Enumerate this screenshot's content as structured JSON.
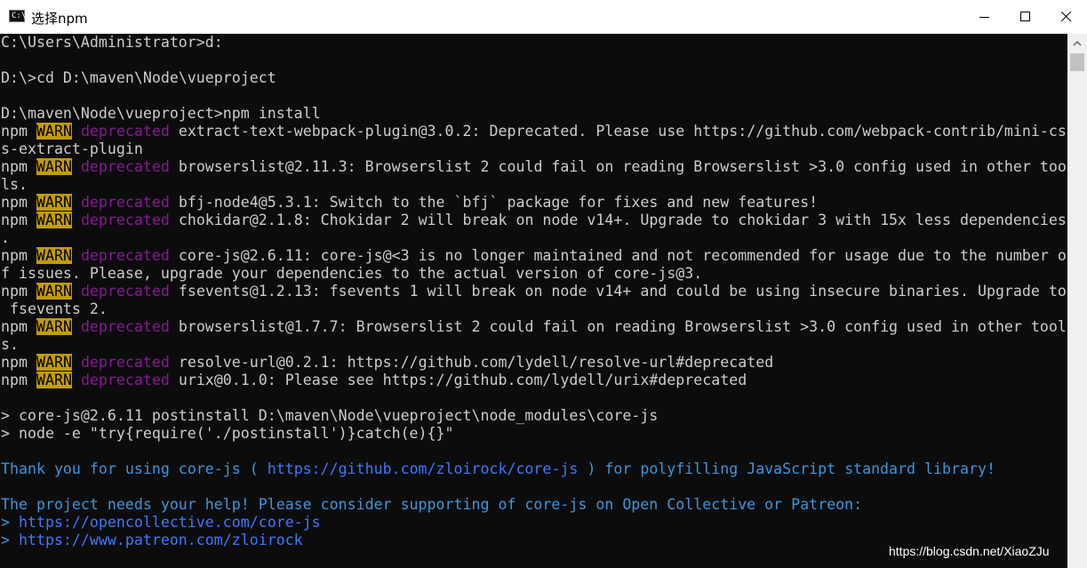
{
  "window": {
    "title": "选择npm",
    "icon_name": "terminal-icon"
  },
  "terminal": {
    "lines": [
      {
        "segments": [
          {
            "text": "C:\\Users\\Administrator>d:",
            "style": "default"
          }
        ]
      },
      {
        "segments": [
          {
            "text": "",
            "style": "default"
          }
        ]
      },
      {
        "segments": [
          {
            "text": "D:\\>cd D:\\maven\\Node\\vueproject",
            "style": "default"
          }
        ]
      },
      {
        "segments": [
          {
            "text": "",
            "style": "default"
          }
        ]
      },
      {
        "segments": [
          {
            "text": "D:\\maven\\Node\\vueproject>npm install",
            "style": "default"
          }
        ]
      },
      {
        "segments": [
          {
            "text": "npm ",
            "style": "default"
          },
          {
            "text": "WARN",
            "style": "warn"
          },
          {
            "text": " ",
            "style": "default"
          },
          {
            "text": "deprecated",
            "style": "dep"
          },
          {
            "text": " extract-text-webpack-plugin@3.0.2: Deprecated. Please use https://github.com/webpack-contrib/mini-cs",
            "style": "default"
          }
        ]
      },
      {
        "segments": [
          {
            "text": "s-extract-plugin",
            "style": "default"
          }
        ]
      },
      {
        "segments": [
          {
            "text": "npm ",
            "style": "default"
          },
          {
            "text": "WARN",
            "style": "warn"
          },
          {
            "text": " ",
            "style": "default"
          },
          {
            "text": "deprecated",
            "style": "dep"
          },
          {
            "text": " browserslist@2.11.3: Browserslist 2 could fail on reading Browserslist >3.0 config used in other too",
            "style": "default"
          }
        ]
      },
      {
        "segments": [
          {
            "text": "ls.",
            "style": "default"
          }
        ]
      },
      {
        "segments": [
          {
            "text": "npm ",
            "style": "default"
          },
          {
            "text": "WARN",
            "style": "warn"
          },
          {
            "text": " ",
            "style": "default"
          },
          {
            "text": "deprecated",
            "style": "dep"
          },
          {
            "text": " bfj-node4@5.3.1: Switch to the `bfj` package for fixes and new features!",
            "style": "default"
          }
        ]
      },
      {
        "segments": [
          {
            "text": "npm ",
            "style": "default"
          },
          {
            "text": "WARN",
            "style": "warn"
          },
          {
            "text": " ",
            "style": "default"
          },
          {
            "text": "deprecated",
            "style": "dep"
          },
          {
            "text": " chokidar@2.1.8: Chokidar 2 will break on node v14+. Upgrade to chokidar 3 with 15x less dependencies",
            "style": "default"
          }
        ]
      },
      {
        "segments": [
          {
            "text": ".",
            "style": "default"
          }
        ]
      },
      {
        "segments": [
          {
            "text": "npm ",
            "style": "default"
          },
          {
            "text": "WARN",
            "style": "warn"
          },
          {
            "text": " ",
            "style": "default"
          },
          {
            "text": "deprecated",
            "style": "dep"
          },
          {
            "text": " core-js@2.6.11: core-js@<3 is no longer maintained and not recommended for usage due to the number o",
            "style": "default"
          }
        ]
      },
      {
        "segments": [
          {
            "text": "f issues. Please, upgrade your dependencies to the actual version of core-js@3.",
            "style": "default"
          }
        ]
      },
      {
        "segments": [
          {
            "text": "npm ",
            "style": "default"
          },
          {
            "text": "WARN",
            "style": "warn"
          },
          {
            "text": " ",
            "style": "default"
          },
          {
            "text": "deprecated",
            "style": "dep"
          },
          {
            "text": " fsevents@1.2.13: fsevents 1 will break on node v14+ and could be using insecure binaries. Upgrade to",
            "style": "default"
          }
        ]
      },
      {
        "segments": [
          {
            "text": " fsevents 2.",
            "style": "default"
          }
        ]
      },
      {
        "segments": [
          {
            "text": "npm ",
            "style": "default"
          },
          {
            "text": "WARN",
            "style": "warn"
          },
          {
            "text": " ",
            "style": "default"
          },
          {
            "text": "deprecated",
            "style": "dep"
          },
          {
            "text": " browserslist@1.7.7: Browserslist 2 could fail on reading Browserslist >3.0 config used in other tool",
            "style": "default"
          }
        ]
      },
      {
        "segments": [
          {
            "text": "s.",
            "style": "default"
          }
        ]
      },
      {
        "segments": [
          {
            "text": "npm ",
            "style": "default"
          },
          {
            "text": "WARN",
            "style": "warn"
          },
          {
            "text": " ",
            "style": "default"
          },
          {
            "text": "deprecated",
            "style": "dep"
          },
          {
            "text": " resolve-url@0.2.1: https://github.com/lydell/resolve-url#deprecated",
            "style": "default"
          }
        ]
      },
      {
        "segments": [
          {
            "text": "npm ",
            "style": "default"
          },
          {
            "text": "WARN",
            "style": "warn"
          },
          {
            "text": " ",
            "style": "default"
          },
          {
            "text": "deprecated",
            "style": "dep"
          },
          {
            "text": " urix@0.1.0: Please see https://github.com/lydell/urix#deprecated",
            "style": "default"
          }
        ]
      },
      {
        "segments": [
          {
            "text": "",
            "style": "default"
          }
        ]
      },
      {
        "segments": [
          {
            "text": "> core-js@2.6.11 postinstall D:\\maven\\Node\\vueproject\\node_modules\\core-js",
            "style": "default"
          }
        ]
      },
      {
        "segments": [
          {
            "text": "> node -e \"try{require('./postinstall')}catch(e){}\"",
            "style": "default"
          }
        ]
      },
      {
        "segments": [
          {
            "text": "",
            "style": "default"
          }
        ]
      },
      {
        "segments": [
          {
            "text": "Thank you for using core-js ( ",
            "style": "cyan"
          },
          {
            "text": "https://github.com/zloirock/core-js",
            "style": "blue"
          },
          {
            "text": " ) for polyfilling JavaScript standard library!",
            "style": "cyan"
          }
        ]
      },
      {
        "segments": [
          {
            "text": "",
            "style": "default"
          }
        ]
      },
      {
        "segments": [
          {
            "text": "The project needs your help! Please consider supporting of core-js on Open Collective or Patreon:",
            "style": "cyan"
          }
        ]
      },
      {
        "segments": [
          {
            "text": "> ",
            "style": "cyan"
          },
          {
            "text": "https://opencollective.com/core-js",
            "style": "blue"
          }
        ]
      },
      {
        "segments": [
          {
            "text": "> ",
            "style": "cyan"
          },
          {
            "text": "https://www.patreon.com/zloirock",
            "style": "blue"
          }
        ]
      }
    ]
  },
  "watermark": {
    "text": "https://blog.csdn.net/XiaoZJu"
  },
  "colors": {
    "background": "#0c0c0c",
    "text": "#cccccc",
    "warn_bg": "#c19c00",
    "deprecated": "#881798",
    "cyan": "#3a96dd",
    "link_blue": "#3b78ff"
  }
}
